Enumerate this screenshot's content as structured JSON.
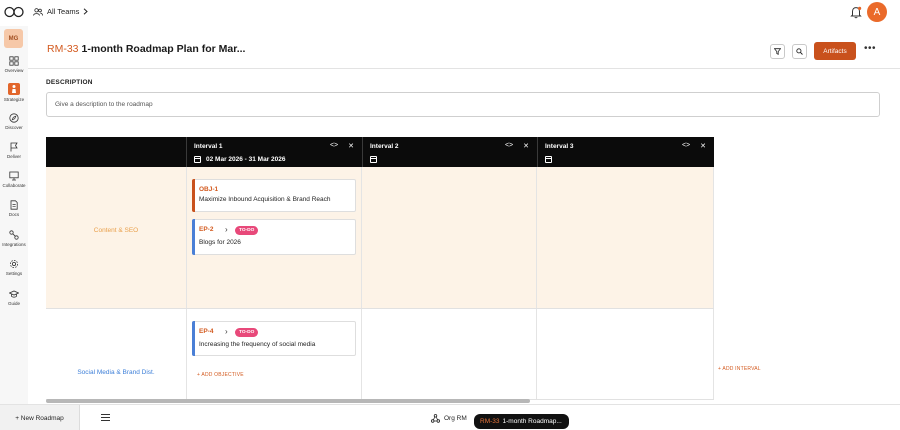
{
  "topbar": {
    "teams_label": "All Teams",
    "avatar_initial": "A"
  },
  "sidebar": {
    "badge": "MG",
    "items": [
      {
        "label": "Overview",
        "icon": "grid-icon"
      },
      {
        "label": "Strategize",
        "icon": "chess-icon",
        "active": true
      },
      {
        "label": "Discover",
        "icon": "compass-icon"
      },
      {
        "label": "Deliver",
        "icon": "flag-icon"
      },
      {
        "label": "Collaborate",
        "icon": "monitor-icon"
      },
      {
        "label": "Docs",
        "icon": "doc-icon"
      },
      {
        "label": "Integrations",
        "icon": "link-icon"
      },
      {
        "label": "Settings",
        "icon": "gear-icon"
      },
      {
        "label": "Guide",
        "icon": "graduation-cap-icon"
      }
    ]
  },
  "header": {
    "key": "RM-33",
    "title": "1-month Roadmap Plan for Mar...",
    "artifacts_label": "Artifacts",
    "more_label": "•••"
  },
  "description": {
    "label": "DESCRIPTION",
    "placeholder": "Give a description to the roadmap"
  },
  "intervals": [
    {
      "name": "Interval 1",
      "dates": "02 Mar 2026  -  31 Mar 2026"
    },
    {
      "name": "Interval 2",
      "dates": ""
    },
    {
      "name": "Interval 3",
      "dates": ""
    }
  ],
  "rows": [
    {
      "label": "Content & SEO",
      "label_color": "#e9a04c",
      "cards": [
        {
          "key": "OBJ-1",
          "title": "Maximize Inbound Acquisition & Brand Reach",
          "bar_color": "#c9511c"
        },
        {
          "key": "EP-2",
          "status": "TO-DO",
          "title": "Blogs for 2026",
          "bar_color": "#4a7fd6"
        }
      ]
    },
    {
      "label": "Social Media & Brand Dist.",
      "label_color": "#3d7fd8",
      "cards": [
        {
          "key": "EP-4",
          "status": "TO-DO",
          "title": "Increasing the frequency of social media",
          "bar_color": "#4a7fd6"
        }
      ],
      "add_objective": "+ ADD OBJECTIVE"
    }
  ],
  "add_interval": "+ ADD INTERVAL",
  "bottombar": {
    "new_roadmap": "+ New Roadmap",
    "org_rm": "Org RM",
    "tab_key": "RM-33",
    "tab_title": "1-month Roadmap..."
  },
  "colors": {
    "accent": "#c9511c",
    "header_bg": "#0b0b0b",
    "row1_bg": "#fdf3e7",
    "status_pill": "#e8497a"
  }
}
